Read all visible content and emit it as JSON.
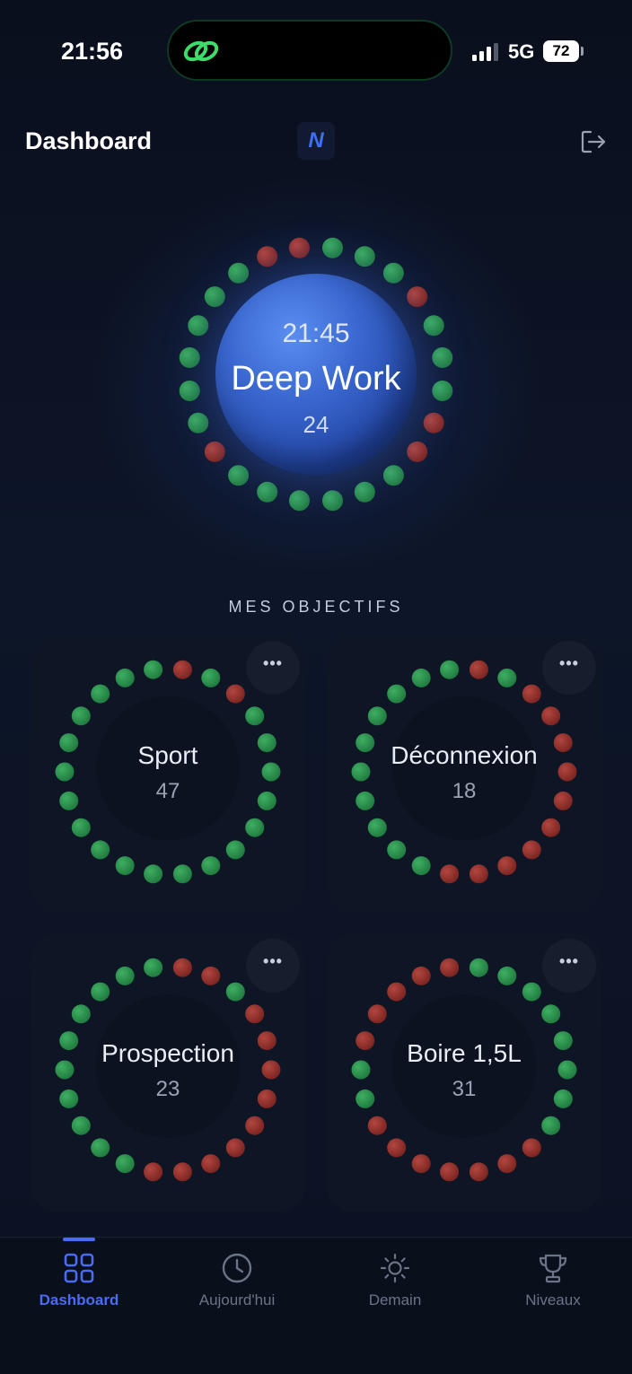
{
  "status_bar": {
    "time": "21:56",
    "network": "5G",
    "battery": "72"
  },
  "header": {
    "title": "Dashboard",
    "logo_text": "N"
  },
  "hero": {
    "time": "21:45",
    "title": "Deep Work",
    "count": "24",
    "dots": [
      "green",
      "green",
      "green",
      "red",
      "green",
      "green",
      "green",
      "red",
      "red",
      "green",
      "green",
      "green",
      "green",
      "green",
      "green",
      "red",
      "green",
      "green",
      "green",
      "green",
      "green",
      "green",
      "red",
      "red"
    ]
  },
  "section": {
    "heading": "MES OBJECTIFS"
  },
  "colors": {
    "green": "#1f7a3e",
    "red": "#7a2420",
    "accent": "#4a6cf2"
  },
  "goals": [
    {
      "name": "Sport",
      "count": "47",
      "more": "•••",
      "dots": [
        "red",
        "green",
        "red",
        "green",
        "green",
        "green",
        "green",
        "green",
        "green",
        "green",
        "green",
        "green",
        "green",
        "green",
        "green",
        "green",
        "green",
        "green",
        "green",
        "green",
        "green",
        "green"
      ]
    },
    {
      "name": "Déconnexion",
      "count": "18",
      "more": "•••",
      "dots": [
        "red",
        "green",
        "red",
        "red",
        "red",
        "red",
        "red",
        "red",
        "red",
        "red",
        "red",
        "red",
        "green",
        "green",
        "green",
        "green",
        "green",
        "green",
        "green",
        "green",
        "green",
        "green"
      ]
    },
    {
      "name": "Prospection",
      "count": "23",
      "more": "•••",
      "dots": [
        "red",
        "red",
        "green",
        "red",
        "red",
        "red",
        "red",
        "red",
        "red",
        "red",
        "red",
        "red",
        "green",
        "green",
        "green",
        "green",
        "green",
        "green",
        "green",
        "green",
        "green",
        "green"
      ]
    },
    {
      "name": "Boire 1,5L",
      "count": "31",
      "more": "•••",
      "dots": [
        "green",
        "green",
        "green",
        "green",
        "green",
        "green",
        "green",
        "green",
        "red",
        "red",
        "red",
        "red",
        "red",
        "red",
        "red",
        "green",
        "green",
        "red",
        "red",
        "red",
        "red",
        "red"
      ]
    }
  ],
  "tabs": [
    {
      "label": "Dashboard",
      "icon": "grid-icon",
      "active": true
    },
    {
      "label": "Aujourd'hui",
      "icon": "clock-icon",
      "active": false
    },
    {
      "label": "Demain",
      "icon": "sun-icon",
      "active": false
    },
    {
      "label": "Niveaux",
      "icon": "trophy-icon",
      "active": false
    }
  ]
}
